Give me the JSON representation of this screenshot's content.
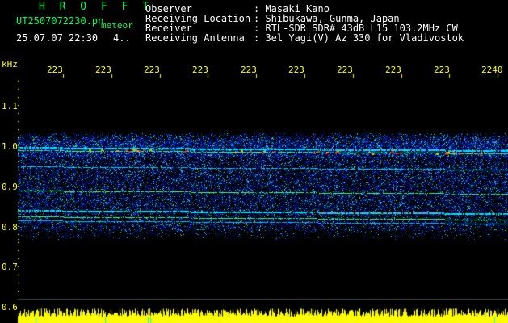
{
  "header": {
    "brand": "H R O F F T",
    "filename": "UT2507072230.pn",
    "mode": "meteor",
    "datetime": "25.07.07 22:30",
    "count": "4.."
  },
  "info": {
    "labels": [
      "Observer",
      "Receiving Location",
      "Receiver",
      "Receiving Antenna"
    ],
    "values": [
      ": Masaki Kano",
      ": Shibukawa, Gunma, Japan",
      ": RTL-SDR SDR# 43dB L15 103.2MHz CW",
      ": 3el Yagi(V) Az 330 for Vladivostok"
    ]
  },
  "axis": {
    "unit": "kHz",
    "y_ticks": [
      "1.1",
      "1.0",
      "0.9",
      "0.8",
      "0.7",
      "0.6"
    ],
    "time_ticks": [
      "223",
      "223",
      "223",
      "223",
      "223",
      "223",
      "223",
      "223",
      "223",
      "2240"
    ]
  },
  "colors": {
    "background": "#000000",
    "header_text": "#ffffff",
    "brand_text": "#00ff55",
    "axis_text": "#ffff00",
    "signal_low": "#0000cc",
    "signal_mid": "#00ccff",
    "signal_high": "#ff2200",
    "power_trace": "#ffff00"
  }
}
